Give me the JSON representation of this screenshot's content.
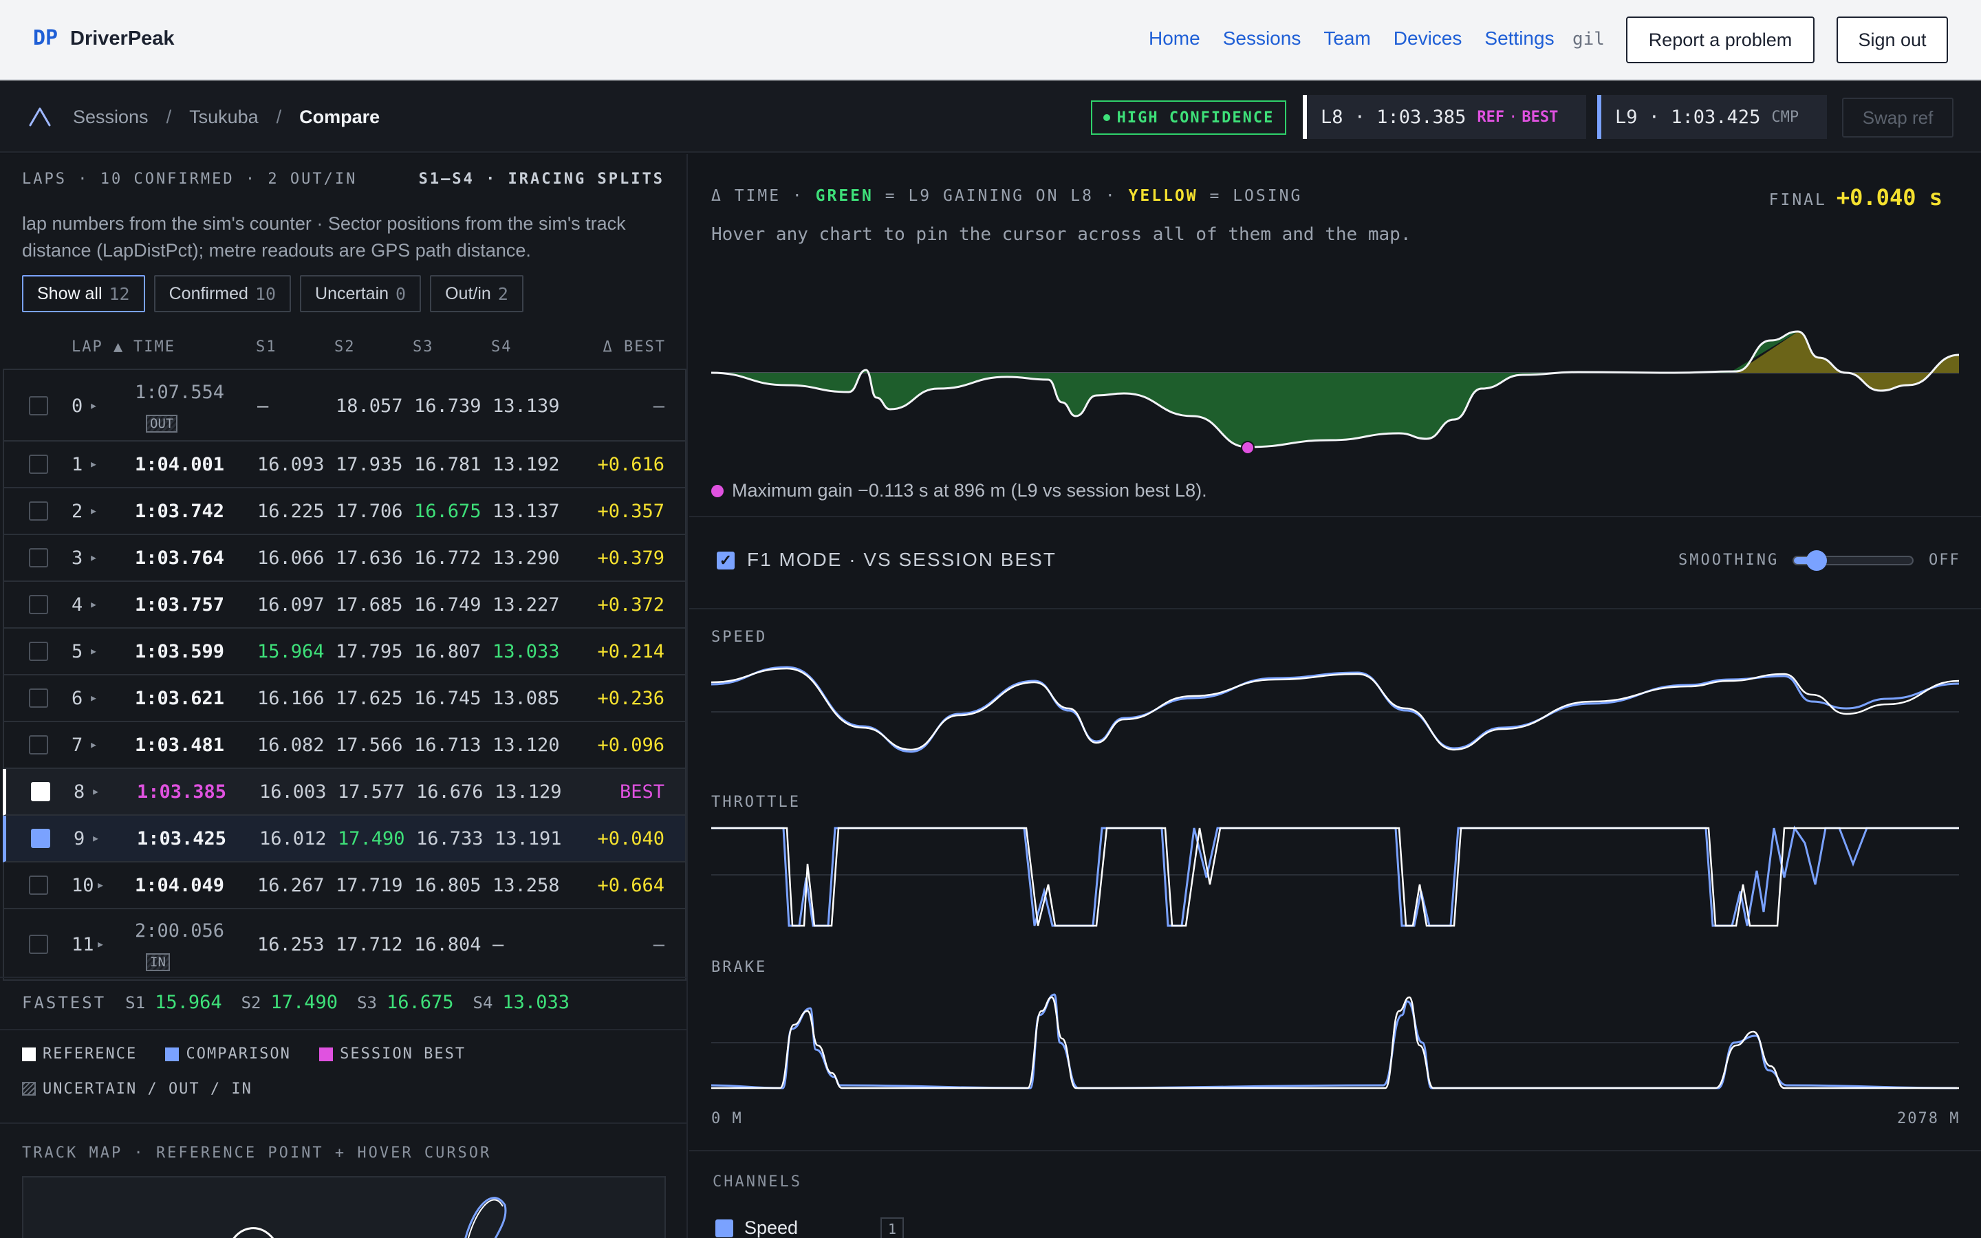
{
  "nav": {
    "brand_mark": "DP",
    "brand_name": "DriverPeak",
    "links": [
      "Home",
      "Sessions",
      "Team",
      "Devices",
      "Settings"
    ],
    "user": "gil",
    "report_label": "Report a problem",
    "signout_label": "Sign out"
  },
  "subbar": {
    "breadcrumb": [
      "Sessions",
      "Tsukuba",
      "Compare"
    ],
    "confidence": "HIGH CONFIDENCE",
    "ref_lap": "L8 · 1:03.385",
    "ref_tag": "REF",
    "ref_best": "BEST",
    "cmp_lap": "L9 · 1:03.425",
    "cmp_tag": "CMP",
    "swap_label": "Swap ref"
  },
  "laps": {
    "header": "LAPS · 10 CONFIRMED · 2 OUT/IN",
    "splits_label": "S1–S4 · IRACING SPLITS",
    "description": "lap numbers from the sim's counter · Sector positions from the sim's track distance (LapDistPct); metre readouts are GPS path distance.",
    "filters": [
      {
        "label": "Show all",
        "count": "12"
      },
      {
        "label": "Confirmed",
        "count": "10"
      },
      {
        "label": "Uncertain",
        "count": "0"
      },
      {
        "label": "Out/in",
        "count": "2"
      }
    ],
    "columns": [
      "LAP ▲",
      "TIME",
      "S1",
      "S2",
      "S3",
      "S4",
      "Δ BEST"
    ],
    "rows": [
      {
        "lap": "0",
        "time": "1:07.554",
        "tag": "OUT",
        "s1": "—",
        "s2": "18.057",
        "s3": "16.739",
        "s4": "13.139",
        "delta": "—"
      },
      {
        "lap": "1",
        "time": "1:04.001",
        "s1": "16.093",
        "s2": "17.935",
        "s3": "16.781",
        "s4": "13.192",
        "delta": "+0.616"
      },
      {
        "lap": "2",
        "time": "1:03.742",
        "s1": "16.225",
        "s2": "17.706",
        "s3": "16.675",
        "s4": "13.137",
        "delta": "+0.357"
      },
      {
        "lap": "3",
        "time": "1:03.764",
        "s1": "16.066",
        "s2": "17.636",
        "s3": "16.772",
        "s4": "13.290",
        "delta": "+0.379"
      },
      {
        "lap": "4",
        "time": "1:03.757",
        "s1": "16.097",
        "s2": "17.685",
        "s3": "16.749",
        "s4": "13.227",
        "delta": "+0.372"
      },
      {
        "lap": "5",
        "time": "1:03.599",
        "s1": "15.964",
        "s2": "17.795",
        "s3": "16.807",
        "s4": "13.033",
        "delta": "+0.214"
      },
      {
        "lap": "6",
        "time": "1:03.621",
        "s1": "16.166",
        "s2": "17.625",
        "s3": "16.745",
        "s4": "13.085",
        "delta": "+0.236"
      },
      {
        "lap": "7",
        "time": "1:03.481",
        "s1": "16.082",
        "s2": "17.566",
        "s3": "16.713",
        "s4": "13.120",
        "delta": "+0.096"
      },
      {
        "lap": "8",
        "time": "1:03.385",
        "s1": "16.003",
        "s2": "17.577",
        "s3": "16.676",
        "s4": "13.129",
        "delta": "BEST"
      },
      {
        "lap": "9",
        "time": "1:03.425",
        "s1": "16.012",
        "s2": "17.490",
        "s3": "16.733",
        "s4": "13.191",
        "delta": "+0.040"
      },
      {
        "lap": "10",
        "time": "1:04.049",
        "s1": "16.267",
        "s2": "17.719",
        "s3": "16.805",
        "s4": "13.258",
        "delta": "+0.664"
      },
      {
        "lap": "11",
        "time": "2:00.056",
        "tag": "IN",
        "s1": "16.253",
        "s2": "17.712",
        "s3": "16.804",
        "s4": "—",
        "delta": "—"
      }
    ],
    "fastest_label": "FASTEST",
    "fastest": {
      "S1": "15.964",
      "S2": "17.490",
      "S3": "16.675",
      "S4": "13.033"
    },
    "legend": {
      "reference": "REFERENCE",
      "comparison": "COMPARISON",
      "session_best": "SESSION BEST",
      "uncertain": "UNCERTAIN / OUT / IN"
    },
    "trackmap_title": "TRACK MAP · REFERENCE POINT + HOVER CURSOR"
  },
  "delta": {
    "title_prefix": "Δ TIME ·",
    "green": "GREEN",
    "green_text": "= L9 GAINING ON L8 ·",
    "yellow": "YELLOW",
    "yellow_text": "= LOSING",
    "final_label": "FINAL",
    "final_value": "+0.040 s",
    "hint": "Hover any chart to pin the cursor across all of them and the map.",
    "max_gain": "Maximum gain −0.113 s at 896 m (L9 vs session best L8)."
  },
  "controls": {
    "f1_mode": "F1 MODE · VS SESSION BEST",
    "smoothing": "SMOOTHING",
    "smoothing_value": "OFF",
    "smoothing_level": 0.1
  },
  "channels": {
    "speed": "SPEED",
    "throttle": "THROTTLE",
    "brake": "BRAKE",
    "x_start": "0 M",
    "x_end": "2078 M",
    "title": "CHANNELS",
    "speed_item": "Speed",
    "speed_count": "1"
  },
  "colors": {
    "reference": "#ffffff",
    "comparison": "#7aa2ff",
    "session_best": "#e052e0",
    "gain": "#1e5e2c",
    "loss": "#6b6418",
    "accent_green": "#3ee079",
    "accent_yellow": "#f5e12f"
  }
}
